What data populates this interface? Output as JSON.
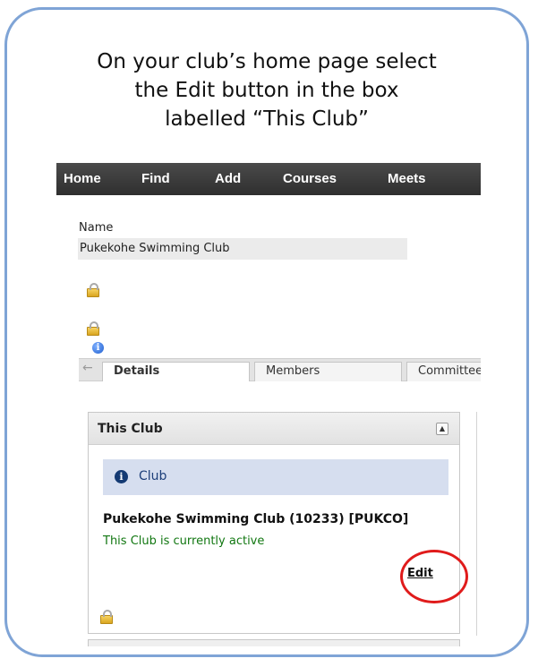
{
  "instruction": {
    "line1": "On your club’s home page select",
    "line2": "the Edit button in the box",
    "line3": "labelled “This Club”"
  },
  "navbar": {
    "items": [
      "Home",
      "Find",
      "Add",
      "Courses",
      "Meets"
    ]
  },
  "name_field": {
    "label": "Name",
    "value": "Pukekohe Swimming Club"
  },
  "tabs": [
    {
      "label": "Details",
      "active": true
    },
    {
      "label": "Members",
      "active": false
    },
    {
      "label": "Committee",
      "active": false
    }
  ],
  "panel": {
    "title": "This Club",
    "info_text": "Club",
    "club_name": "Pukekohe Swimming Club (10233) [PUKCO]",
    "status": "This Club is currently active",
    "edit_label": "Edit"
  },
  "colors": {
    "frame_border": "#7fa4d6",
    "navbar": "#3a3a3a",
    "status_text": "#117711",
    "info_box": "#d6deef",
    "highlight_circle": "#e01b1b"
  },
  "icons": [
    "lock-icon",
    "info-icon",
    "collapse-icon",
    "back-arrow-icon"
  ]
}
